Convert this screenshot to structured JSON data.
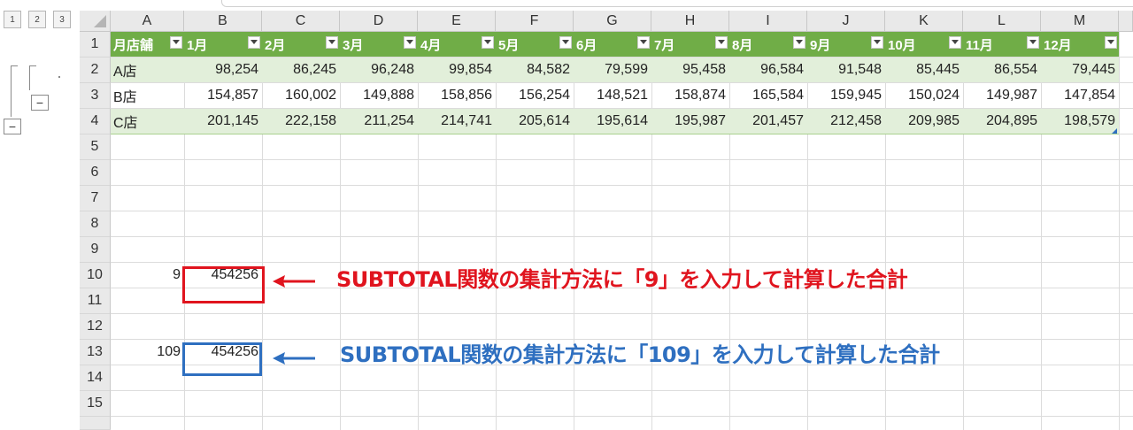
{
  "outline": {
    "levels": [
      "1",
      "2",
      "3"
    ],
    "collapse_symbol": "−"
  },
  "columns": [
    "A",
    "B",
    "C",
    "D",
    "E",
    "F",
    "G",
    "H",
    "I",
    "J",
    "K",
    "L",
    "M"
  ],
  "rows": [
    "1",
    "2",
    "3",
    "4",
    "5",
    "6",
    "7",
    "8",
    "9",
    "10",
    "11",
    "12",
    "13",
    "14",
    "15"
  ],
  "table": {
    "headers": [
      "月店舗",
      "1月",
      "2月",
      "3月",
      "4月",
      "5月",
      "6月",
      "7月",
      "8月",
      "9月",
      "10月",
      "11月",
      "12月"
    ],
    "data": [
      [
        "A店",
        "98,254",
        "86,245",
        "96,248",
        "99,854",
        "84,582",
        "79,599",
        "95,458",
        "96,584",
        "91,548",
        "85,445",
        "86,554",
        "79,445"
      ],
      [
        "B店",
        "154,857",
        "160,002",
        "149,888",
        "158,856",
        "156,254",
        "148,521",
        "158,874",
        "165,584",
        "159,945",
        "150,024",
        "149,987",
        "147,854"
      ],
      [
        "C店",
        "201,145",
        "222,158",
        "211,254",
        "214,741",
        "205,614",
        "195,614",
        "195,987",
        "201,457",
        "212,458",
        "209,985",
        "204,895",
        "198,579"
      ]
    ],
    "header_color": "#70ad47",
    "band_color": "#e2efda"
  },
  "results": {
    "row10": {
      "a": "9",
      "b": "454256"
    },
    "row13": {
      "a": "109",
      "b": "454256"
    }
  },
  "annotations": {
    "red": {
      "text": "SUBTOTAL関数の集計方法に「9」を入力して計算した合計",
      "color": "#e0141e"
    },
    "blue": {
      "text": "SUBTOTAL関数の集計方法に「109」を入力して計算した合計",
      "color": "#2e6fc0"
    }
  }
}
